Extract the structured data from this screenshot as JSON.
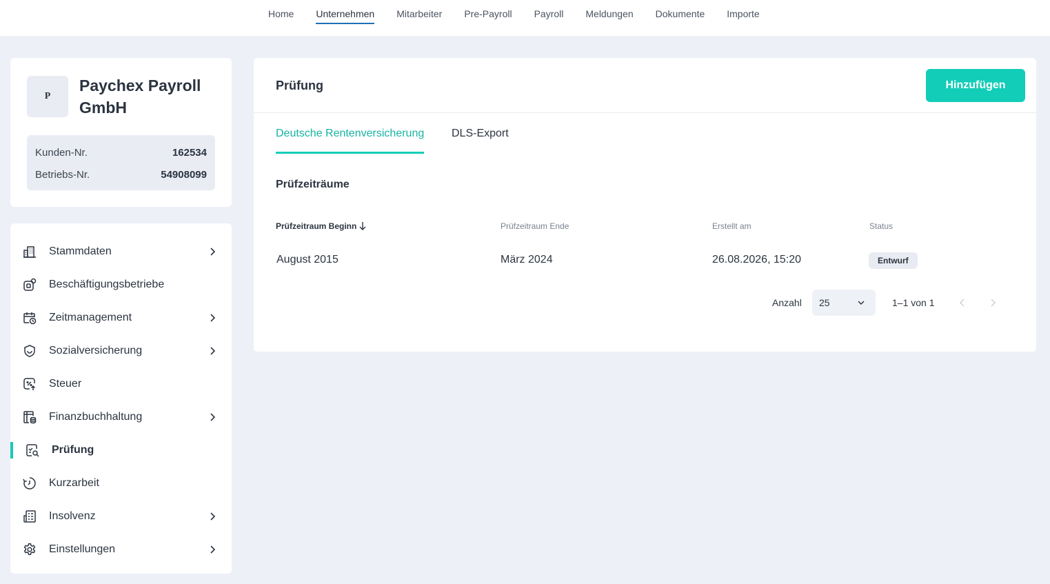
{
  "topnav": {
    "items": [
      {
        "label": "Home"
      },
      {
        "label": "Unternehmen",
        "active": true
      },
      {
        "label": "Mitarbeiter"
      },
      {
        "label": "Pre-Payroll"
      },
      {
        "label": "Payroll"
      },
      {
        "label": "Meldungen"
      },
      {
        "label": "Dokumente"
      },
      {
        "label": "Importe"
      }
    ]
  },
  "company": {
    "avatar_letter": "P",
    "name": "Paychex Payroll GmbH",
    "customer_label": "Kunden-Nr.",
    "customer_value": "162534",
    "company_label": "Betriebs-Nr.",
    "company_value": "54908099"
  },
  "sidebar": {
    "items": [
      {
        "label": "Stammdaten",
        "icon": "building-icon",
        "has_children": true
      },
      {
        "label": "Beschäftigungsbetriebe",
        "icon": "business-location-icon",
        "has_children": false
      },
      {
        "label": "Zeitmanagement",
        "icon": "calendar-clock-icon",
        "has_children": true
      },
      {
        "label": "Sozialversicherung",
        "icon": "shield-icon",
        "has_children": true
      },
      {
        "label": "Steuer",
        "icon": "tax-percent-icon",
        "has_children": false
      },
      {
        "label": "Finanzbuchhaltung",
        "icon": "ledger-icon",
        "has_children": true
      },
      {
        "label": "Prüfung",
        "icon": "audit-search-icon",
        "has_children": false,
        "active": true
      },
      {
        "label": "Kurzarbeit",
        "icon": "timer-icon",
        "has_children": false
      },
      {
        "label": "Insolvenz",
        "icon": "document-list-icon",
        "has_children": true
      },
      {
        "label": "Einstellungen",
        "icon": "gear-icon",
        "has_children": true
      }
    ]
  },
  "main": {
    "title": "Prüfung",
    "add_button": "Hinzufügen",
    "tabs": [
      {
        "label": "Deutsche Rentenversicherung",
        "active": true
      },
      {
        "label": "DLS-Export",
        "active": false
      }
    ],
    "section_title": "Prüfzeiträume",
    "table": {
      "columns": [
        "Prüfzeitraum Beginn",
        "Prüfzeitraum Ende",
        "Erstellt am",
        "Status"
      ],
      "sort_column": "Prüfzeitraum Beginn",
      "sort_direction": "descending",
      "rows": [
        {
          "begin": "August 2015",
          "end": "März 2024",
          "created": "26.08.2026, 15:20",
          "status": "Entwurf"
        }
      ]
    },
    "pagination": {
      "label": "Anzahl",
      "page_size": "25",
      "range": "1–1 von 1"
    }
  },
  "colors": {
    "accent": "#12cdb8",
    "accent_text": "#17b3a3",
    "nav_underline": "#1f6fb5",
    "background": "#edf0f7"
  }
}
